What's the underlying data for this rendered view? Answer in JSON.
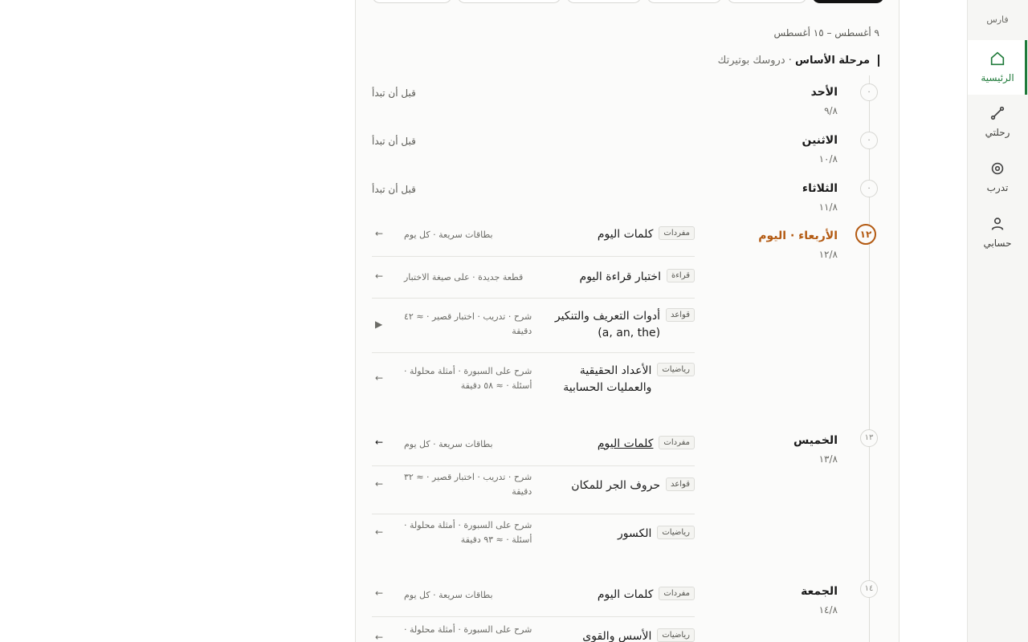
{
  "rail": {
    "brand": "فارس",
    "items": [
      {
        "label": "الرئيسية",
        "icon": "home-icon"
      },
      {
        "label": "رحلتي",
        "icon": "path-icon"
      },
      {
        "label": "تدرب",
        "icon": "target-icon"
      },
      {
        "label": "حسابي",
        "icon": "user-icon"
      }
    ]
  },
  "header": {
    "date_range": "٩ أغسطس – ١٥ أغسطس",
    "stage_bold": "مرحلة الأساس",
    "stage_sub": "· دروسك بوتيرتك"
  },
  "colors": {
    "accent": "#1f7a3a",
    "today": "#b35a12"
  },
  "days": [
    {
      "num": "٠",
      "name": "الأحد",
      "date": "٩/٨",
      "note": "قبل أن تبدأ"
    },
    {
      "num": "٠",
      "name": "الاثنين",
      "date": "١٠/٨",
      "note": "قبل أن تبدأ"
    },
    {
      "num": "٠",
      "name": "الثلاثاء",
      "date": "١١/٨",
      "note": "قبل أن تبدأ"
    },
    {
      "num": "١٢",
      "name": "الأربعاء · اليوم",
      "date": "١٢/٨",
      "tasks": [
        {
          "tag": "مفردات",
          "title": "كلمات اليوم",
          "meta": "بطاقات سريعة · كل يوم",
          "arrow": "←"
        },
        {
          "tag": "قراءة",
          "title": "اختبار قراءة اليوم",
          "meta": "قطعة جديدة · على صيغة الاختبار",
          "arrow": "←"
        },
        {
          "tag": "قواعد",
          "title": "أدوات التعريف والتنكير",
          "title2": "(a, an, the)",
          "meta": "شرح · تدريب · اختبار قصير · ≈ ٤٢",
          "meta2": "دقيقة",
          "arrow": "▶"
        },
        {
          "tag": "رياضيات",
          "title": "الأعداد الحقيقية",
          "title2": "والعمليات الحسابية",
          "meta": "شرح على السبورة · أمثلة محلولة ·",
          "meta2": "أسئلة · ≈ ٥٨ دقيقة",
          "arrow": "←"
        }
      ]
    },
    {
      "num": "١٣",
      "name": "الخميس",
      "date": "١٣/٨",
      "tasks": [
        {
          "tag": "مفردات",
          "title": "كلمات اليوم",
          "meta": "بطاقات سريعة · كل يوم",
          "arrow": "←"
        },
        {
          "tag": "قواعد",
          "title": "حروف الجر للمكان",
          "meta": "شرح · تدريب · اختبار قصير · ≈ ٣٢",
          "meta2": "دقيقة",
          "arrow": "←"
        },
        {
          "tag": "رياضيات",
          "title": "الكسور",
          "meta": "شرح على السبورة · أمثلة محلولة ·",
          "meta2": "أسئلة · ≈ ٩٣ دقيقة",
          "arrow": "←"
        }
      ]
    },
    {
      "num": "١٤",
      "name": "الجمعة",
      "date": "١٤/٨",
      "tasks": [
        {
          "tag": "مفردات",
          "title": "كلمات اليوم",
          "meta": "بطاقات سريعة · كل يوم",
          "arrow": "←"
        },
        {
          "tag": "رياضيات",
          "title": "الأسس والقوى",
          "meta": "شرح على السبورة · أمثلة محلولة ·",
          "arrow": "←"
        }
      ]
    }
  ]
}
